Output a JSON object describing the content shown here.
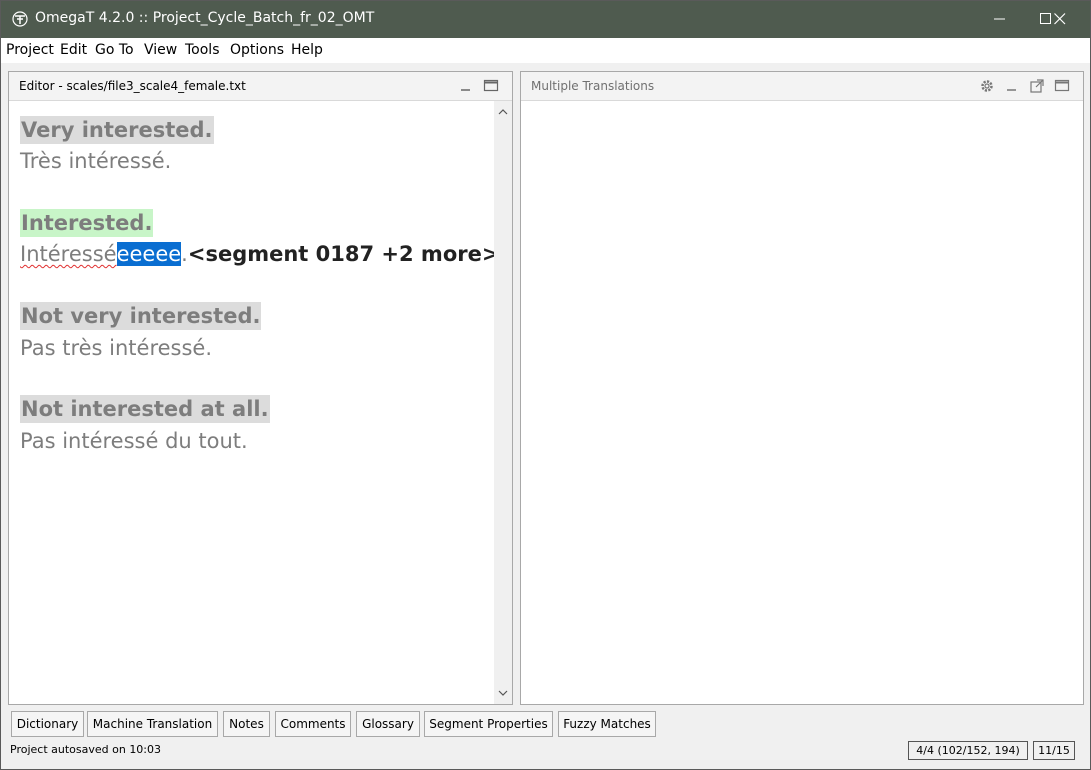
{
  "window": {
    "title": "OmegaT 4.2.0 :: Project_Cycle_Batch_fr_02_OMT",
    "app_icon": "omegat-logo-icon",
    "controls": [
      "minimize-icon",
      "maximize-icon",
      "close-icon"
    ]
  },
  "menu": [
    "Project",
    "Edit",
    "Go To",
    "View",
    "Tools",
    "Options",
    "Help"
  ],
  "editor": {
    "title": "Editor - scales/file3_scale4_female.txt",
    "segments": [
      {
        "source": "Very interested.",
        "target": "Très intéressé."
      },
      {
        "source": "Interested.",
        "target_plain": "Intéressé",
        "target_selected": "eeeee",
        "target_after": ".",
        "marker": "<segment 0187 +2 more>"
      },
      {
        "source": "Not very interested.",
        "target": "Pas très intéressé."
      },
      {
        "source": "Not interested at all.",
        "target": "Pas intéressé du tout."
      }
    ]
  },
  "multiple_translations": {
    "title": "Multiple Translations",
    "header_icons": [
      "gear-icon",
      "minimize-pane-icon",
      "undock-icon",
      "maximize-pane-icon"
    ]
  },
  "tabs": [
    "Dictionary",
    "Machine Translation",
    "Notes",
    "Comments",
    "Glossary",
    "Segment Properties",
    "Fuzzy Matches"
  ],
  "status": {
    "message": "Project autosaved on 10:03",
    "progress": "4/4 (102/152, 194)",
    "segment_count": "11/15"
  },
  "colors": {
    "titlebar": "#4f5b4f",
    "active_segment_source_bg": "#c8f5c8",
    "inactive_segment_source_bg": "#dcdcdc",
    "selection": "#0a6ed1"
  }
}
